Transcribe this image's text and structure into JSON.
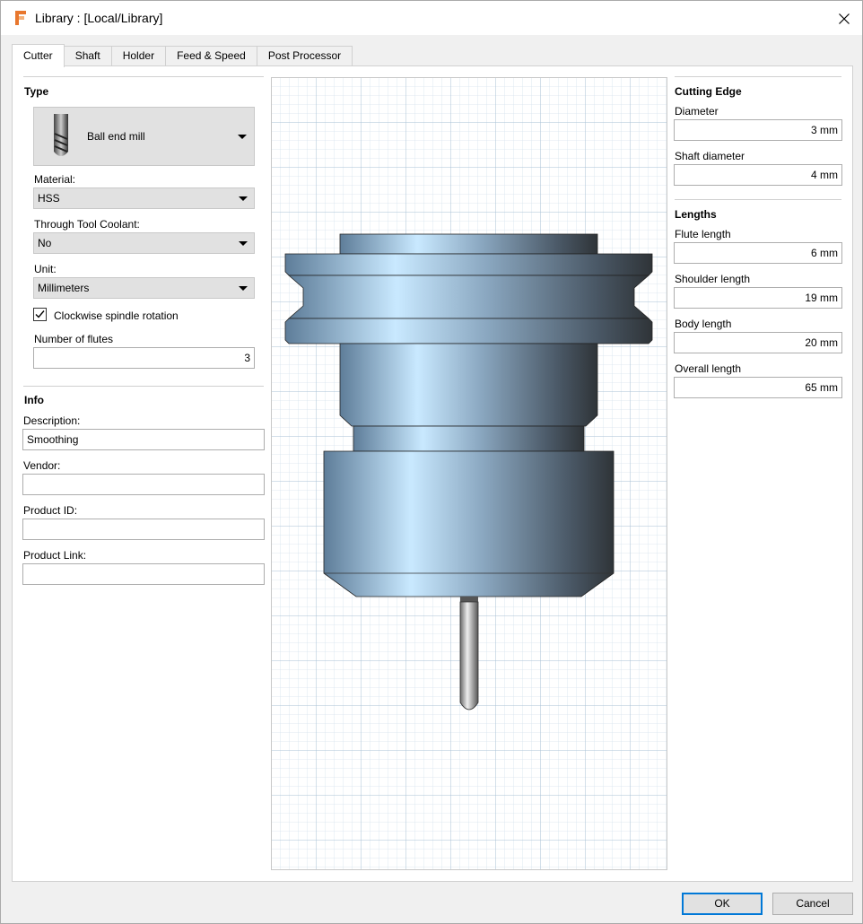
{
  "window": {
    "title": "Library :  [Local/Library]"
  },
  "tabs": [
    {
      "label": "Cutter",
      "active": true
    },
    {
      "label": "Shaft",
      "active": false
    },
    {
      "label": "Holder",
      "active": false
    },
    {
      "label": "Feed & Speed",
      "active": false
    },
    {
      "label": "Post Processor",
      "active": false
    }
  ],
  "type_section": {
    "title": "Type",
    "tool_type": "Ball end mill",
    "material_label": "Material:",
    "material_value": "HSS",
    "coolant_label": "Through Tool Coolant:",
    "coolant_value": "No",
    "unit_label": "Unit:",
    "unit_value": "Millimeters",
    "clockwise_label": "Clockwise spindle rotation",
    "clockwise_checked": true,
    "flutes_label": "Number of flutes",
    "flutes_value": "3"
  },
  "info_section": {
    "title": "Info",
    "description_label": "Description:",
    "description_value": "Smoothing",
    "vendor_label": "Vendor:",
    "vendor_value": "",
    "product_id_label": "Product ID:",
    "product_id_value": "",
    "product_link_label": "Product Link:",
    "product_link_value": ""
  },
  "cutting_edge": {
    "title": "Cutting Edge",
    "diameter_label": "Diameter",
    "diameter_value": "3 mm",
    "shaft_diameter_label": "Shaft diameter",
    "shaft_diameter_value": "4 mm"
  },
  "lengths": {
    "title": "Lengths",
    "flute_label": "Flute length",
    "flute_value": "6 mm",
    "shoulder_label": "Shoulder length",
    "shoulder_value": "19 mm",
    "body_label": "Body length",
    "body_value": "20 mm",
    "overall_label": "Overall length",
    "overall_value": "65 mm"
  },
  "buttons": {
    "ok": "OK",
    "cancel": "Cancel"
  },
  "colors": {
    "accent": "#0078d7",
    "app_icon": "#e8772e",
    "grid_line": "#b8cfe0"
  }
}
